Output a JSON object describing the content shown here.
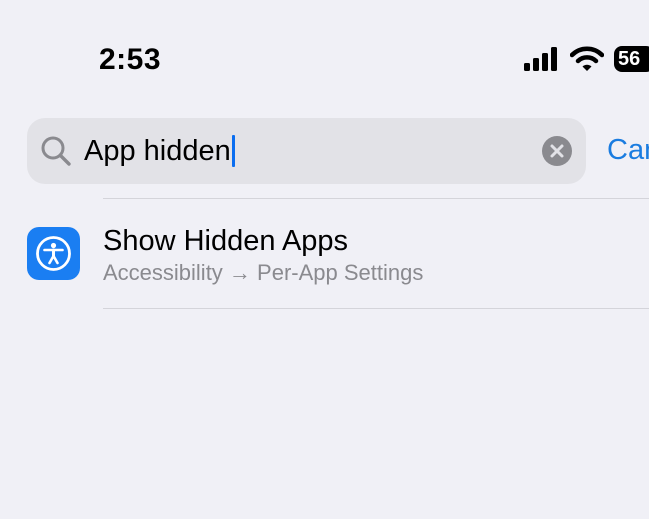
{
  "status_bar": {
    "time": "2:53",
    "battery": "56",
    "icons": [
      "signal-icon",
      "wifi-icon",
      "battery-icon"
    ]
  },
  "search": {
    "query": "App hidden",
    "cancel_label": "Cancel",
    "icons": [
      "search-icon",
      "clear-icon"
    ]
  },
  "results": [
    {
      "title": "Show Hidden Apps",
      "path": "Accessibility → Per-App Settings",
      "icon": "accessibility-icon",
      "icon_color": "#1a7ef2"
    }
  ],
  "colors": {
    "background": "#f0f0f6",
    "accent": "#1a7ce0",
    "secondary_text": "#8a8a8f"
  }
}
